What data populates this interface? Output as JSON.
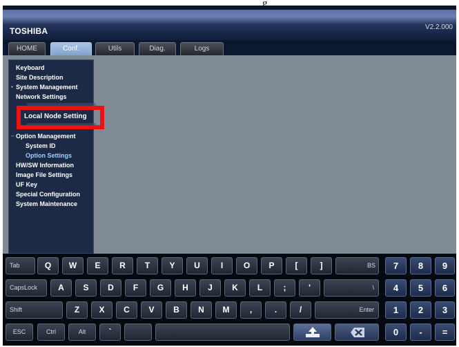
{
  "window": {
    "brand": "TOSHIBA",
    "version": "V2.2.000",
    "top_partial_text": "g"
  },
  "tabs": [
    {
      "label": "HOME",
      "active": false
    },
    {
      "label": "Conf.",
      "active": true
    },
    {
      "label": "Utils",
      "active": false
    },
    {
      "label": "Diag.",
      "active": false
    },
    {
      "label": "Logs",
      "active": false
    }
  ],
  "sidebar": {
    "items": [
      {
        "label": "Keyboard"
      },
      {
        "label": "Site Description"
      },
      {
        "label": "System Management"
      },
      {
        "label": "Network Settings"
      },
      {
        "label": "Local Node Setting"
      },
      {
        "label": "Option Management"
      },
      {
        "label": "System ID"
      },
      {
        "label": "Option Settings",
        "selected": true
      },
      {
        "label": "HW/SW Information"
      },
      {
        "label": "Image File Settings"
      },
      {
        "label": "UF Key"
      },
      {
        "label": "Special Configuration"
      },
      {
        "label": "System Maintenance"
      }
    ]
  },
  "keyboard": {
    "row1": [
      "Tab",
      "Q",
      "W",
      "E",
      "R",
      "T",
      "Y",
      "U",
      "I",
      "O",
      "P",
      "[",
      "]",
      "BS",
      "7",
      "8",
      "9"
    ],
    "row2": [
      "CapsLock",
      "A",
      "S",
      "D",
      "F",
      "G",
      "H",
      "J",
      "K",
      "L",
      ";",
      "'",
      "\\",
      "4",
      "5",
      "6"
    ],
    "row3": [
      "Shift",
      "Z",
      "X",
      "C",
      "V",
      "B",
      "N",
      "M",
      ",",
      ".",
      "/",
      "Enter",
      "1",
      "2",
      "3"
    ],
    "row4": [
      "ESC",
      "Ctrl",
      "Alt",
      "`",
      "",
      "",
      "",
      "0",
      "-",
      "="
    ],
    "icons": {
      "upload": "upload-icon",
      "clear": "clear-x-icon"
    }
  }
}
